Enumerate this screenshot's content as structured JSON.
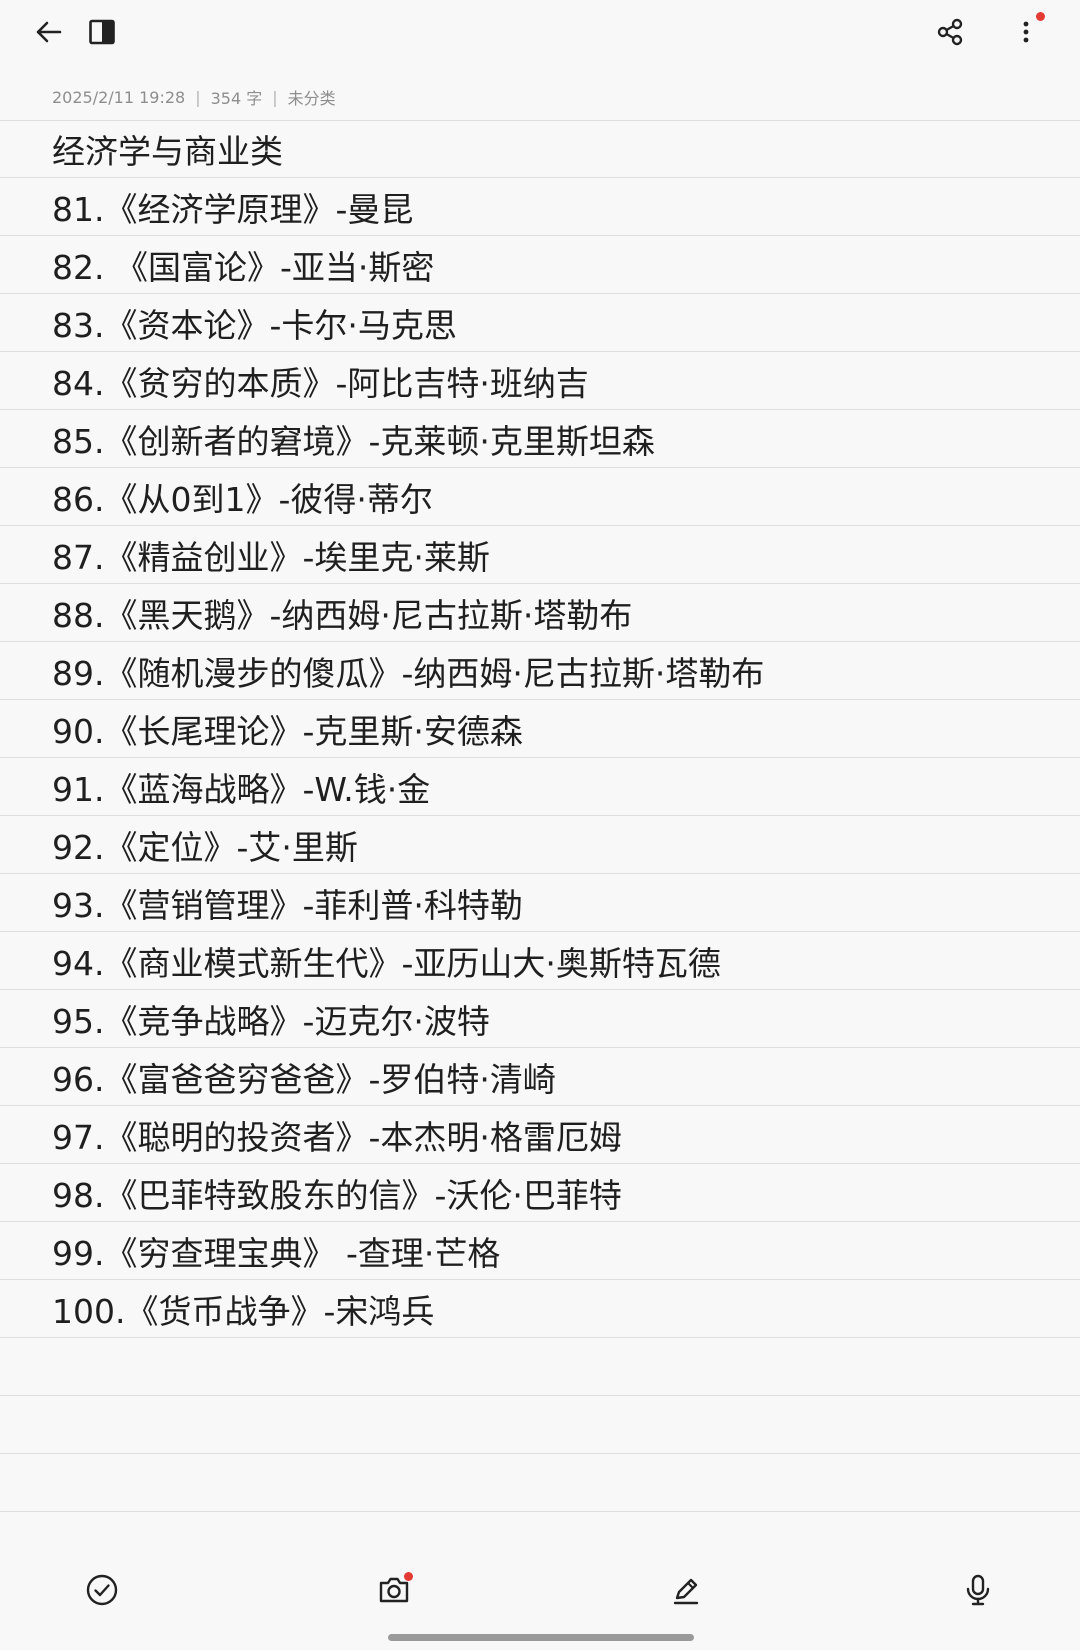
{
  "meta": {
    "datetime": "2025/2/11 19:28",
    "separator": "|",
    "word_count": "354 字",
    "category": "未分类"
  },
  "toolbar": {
    "back_icon": "arrow-left-icon",
    "panel_icon": "panel-toggle-icon",
    "share_icon": "share-icon",
    "more_icon": "more-vertical-icon",
    "notification_color": "#e53935"
  },
  "note": {
    "title": "经济学与商业类",
    "lines": [
      "81.《经济学原理》-曼昆",
      "82. 《国富论》-亚当·斯密",
      "83.《资本论》-卡尔·马克思",
      "84.《贫穷的本质》-阿比吉特·班纳吉",
      "85.《创新者的窘境》-克莱顿·克里斯坦森",
      "86.《从0到1》-彼得·蒂尔",
      "87.《精益创业》-埃里克·莱斯",
      "88.《黑天鹅》-纳西姆·尼古拉斯·塔勒布",
      "89.《随机漫步的傻瓜》-纳西姆·尼古拉斯·塔勒布",
      "90.《长尾理论》-克里斯·安德森",
      "91.《蓝海战略》-W.钱·金",
      "92.《定位》-艾·里斯",
      "93.《营销管理》-菲利普·科特勒",
      "94.《商业模式新生代》-亚历山大·奥斯特瓦德",
      "95.《竞争战略》-迈克尔·波特",
      "96.《富爸爸穷爸爸》-罗伯特·清崎",
      "97.《聪明的投资者》-本杰明·格雷厄姆",
      "98.《巴菲特致股东的信》-沃伦·巴菲特",
      "99.《穷查理宝典》 -查理·芒格",
      "100.《货币战争》-宋鸿兵"
    ]
  },
  "bottom_toolbar": {
    "checklist_icon": "checklist-icon",
    "camera_icon": "camera-icon",
    "handwriting_icon": "pen-icon",
    "voice_icon": "microphone-icon"
  }
}
